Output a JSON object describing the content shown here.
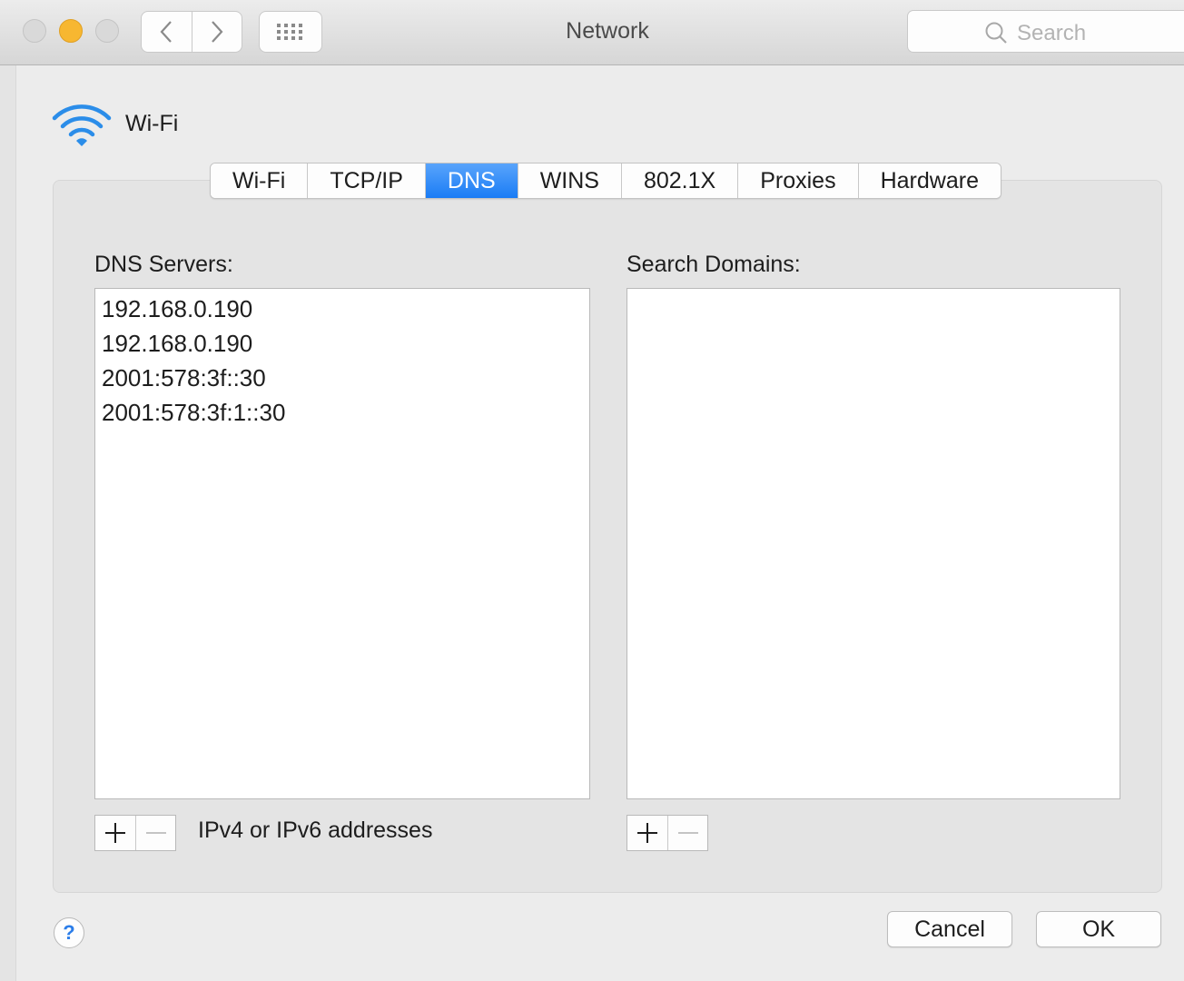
{
  "window": {
    "title": "Network",
    "search_placeholder": "Search"
  },
  "service": {
    "name": "Wi-Fi"
  },
  "tabs": [
    {
      "label": "Wi-Fi"
    },
    {
      "label": "TCP/IP"
    },
    {
      "label": "DNS",
      "active": true
    },
    {
      "label": "WINS"
    },
    {
      "label": "802.1X"
    },
    {
      "label": "Proxies"
    },
    {
      "label": "Hardware"
    }
  ],
  "dns": {
    "servers_label": "DNS Servers:",
    "servers": [
      "192.168.0.190",
      "192.168.0.190",
      "2001:578:3f::30",
      "2001:578:3f:1::30"
    ],
    "hint": "IPv4 or IPv6 addresses",
    "search_domains_label": "Search Domains:"
  },
  "footer": {
    "help": "?",
    "cancel_label": "Cancel",
    "ok_label": "OK"
  },
  "colors": {
    "accent": "#1a7cf5",
    "wifi_icon": "#2b8de9",
    "minimize": "#f7b731"
  }
}
